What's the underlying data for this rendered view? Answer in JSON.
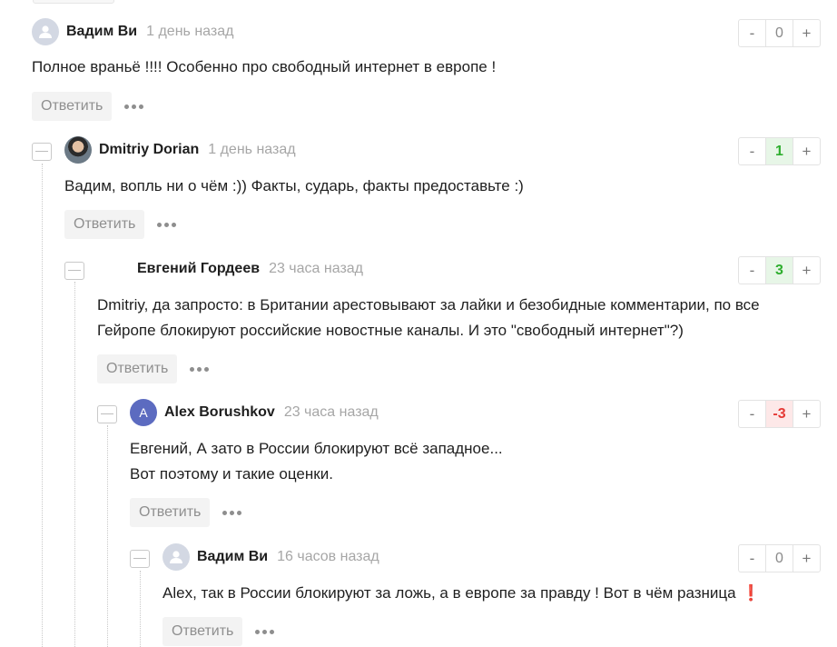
{
  "vote_labels": {
    "minus": "-",
    "plus": "+"
  },
  "comments": [
    {
      "author": "Вадим Ви",
      "time": "1 день назад",
      "avatar": "default-user-icon",
      "text_lines": [
        "Полное враньё !!!! Особенно про свободный интернет в европе !"
      ],
      "score": "0",
      "reply_label": "Ответить"
    },
    {
      "author": "Dmitriy Dorian",
      "time": "1 день назад",
      "avatar": "user-photo",
      "text_lines": [
        "Вадим, вопль ни о чём :)) Факты, сударь, факты предоставьте :)"
      ],
      "score": "1",
      "reply_label": "Ответить"
    },
    {
      "author": "Евгений Гордеев",
      "time": "23 часа назад",
      "avatar": "none",
      "text_lines": [
        "Dmitriy, да запросто: в Британии арестовывают за лайки и безобидные комментарии, по все",
        "Гейропе блокируют российские новостные каналы. И это \"свободный интернет\"?)"
      ],
      "score": "3",
      "reply_label": "Ответить"
    },
    {
      "author": "Alex Borushkov",
      "time": "23 часа назад",
      "avatar": "A",
      "text_lines": [
        "Евгений, А зато в России блокируют всё западное...",
        "Вот поэтому и такие оценки."
      ],
      "score": "-3",
      "reply_label": "Ответить"
    },
    {
      "author": "Вадим Ви",
      "time": "16 часов назад",
      "avatar": "default-user-icon",
      "text_lines": [
        "Alex, так в России блокируют за ложь, а в европе за правду ! Вот в чём разница"
      ],
      "emoji": "❗",
      "score": "0",
      "reply_label": "Ответить"
    }
  ]
}
